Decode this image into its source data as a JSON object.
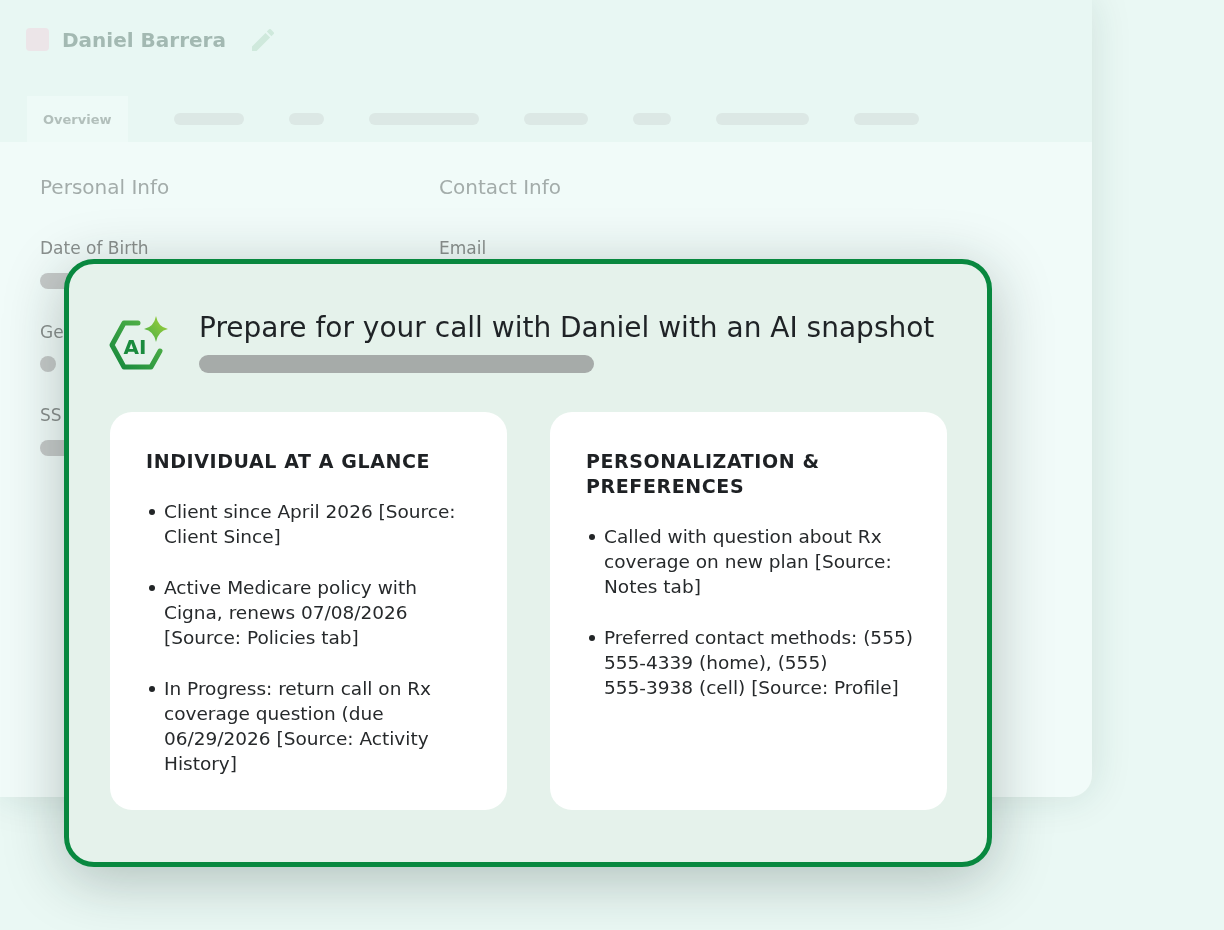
{
  "profile": {
    "name": "Daniel Barrera",
    "tabs": [
      {
        "label": "Overview",
        "selected": true
      }
    ],
    "sections": [
      {
        "title": "Personal Info",
        "fields": [
          {
            "label": "Date of Birth",
            "kind": "bar"
          },
          {
            "label": "Ge",
            "kind": "dot"
          },
          {
            "label": "SS",
            "kind": "bar"
          }
        ]
      },
      {
        "title": "Contact Info",
        "fields": [
          {
            "label": "Email"
          }
        ]
      }
    ]
  },
  "snapshot": {
    "logo_text": "AI",
    "title": "Prepare for your call with Daniel with an AI snapshot",
    "cards": [
      {
        "heading": "INDIVIDUAL AT A GLANCE",
        "items": [
          "Client since April 2026 [Source: Client Since]",
          "Active Medicare policy with Cigna, renews 07/08/2026 [Source: Policies tab]",
          "In Progress: return call on Rx coverage question (due 06/29/2026 [Source: Activity History]"
        ]
      },
      {
        "heading": "PERSONALIZATION & PREFERENCES",
        "items": [
          "Called with question about Rx coverage on new plan [Source: Notes tab]",
          "Preferred contact methods: (555) 555-4339 (home), (555) 555-3938 (cell) [Source: Profile]"
        ]
      }
    ]
  }
}
